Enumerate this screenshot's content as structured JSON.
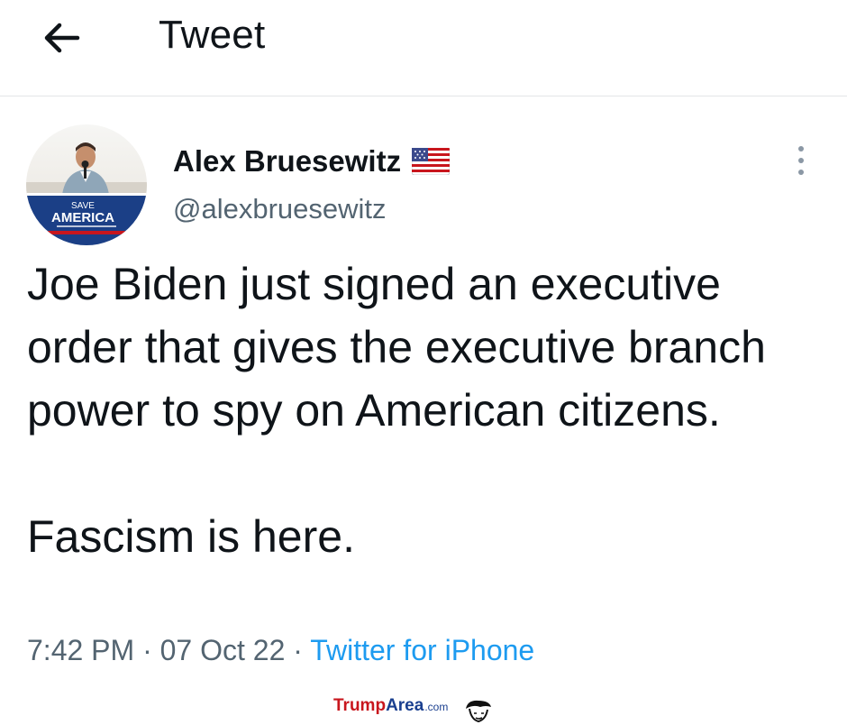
{
  "header": {
    "title": "Tweet",
    "back_icon": "arrow-left-icon"
  },
  "author": {
    "display_name": "Alex Bruesewitz",
    "handle": "@alexbruesewitz",
    "name_badge_icon": "us-flag-icon",
    "avatar_sign_line1": "SAVE",
    "avatar_sign_line2": "AMERICA"
  },
  "tweet": {
    "text_para1": "Joe Biden just signed an executive order that gives the executive branch power to spy on American citizens.",
    "text_para2": "Fascism is here.",
    "time": "7:42 PM",
    "date": "07 Oct 22",
    "separator": "·",
    "source": "Twitter for iPhone"
  },
  "more_menu_icon": "more-vertical-icon",
  "watermark": {
    "part1": "Trump",
    "part2": "Area",
    "part3": ".com"
  },
  "colors": {
    "text": "#0f1419",
    "secondary": "#536471",
    "link": "#1d9bf0",
    "divider": "#e3e6e8"
  }
}
